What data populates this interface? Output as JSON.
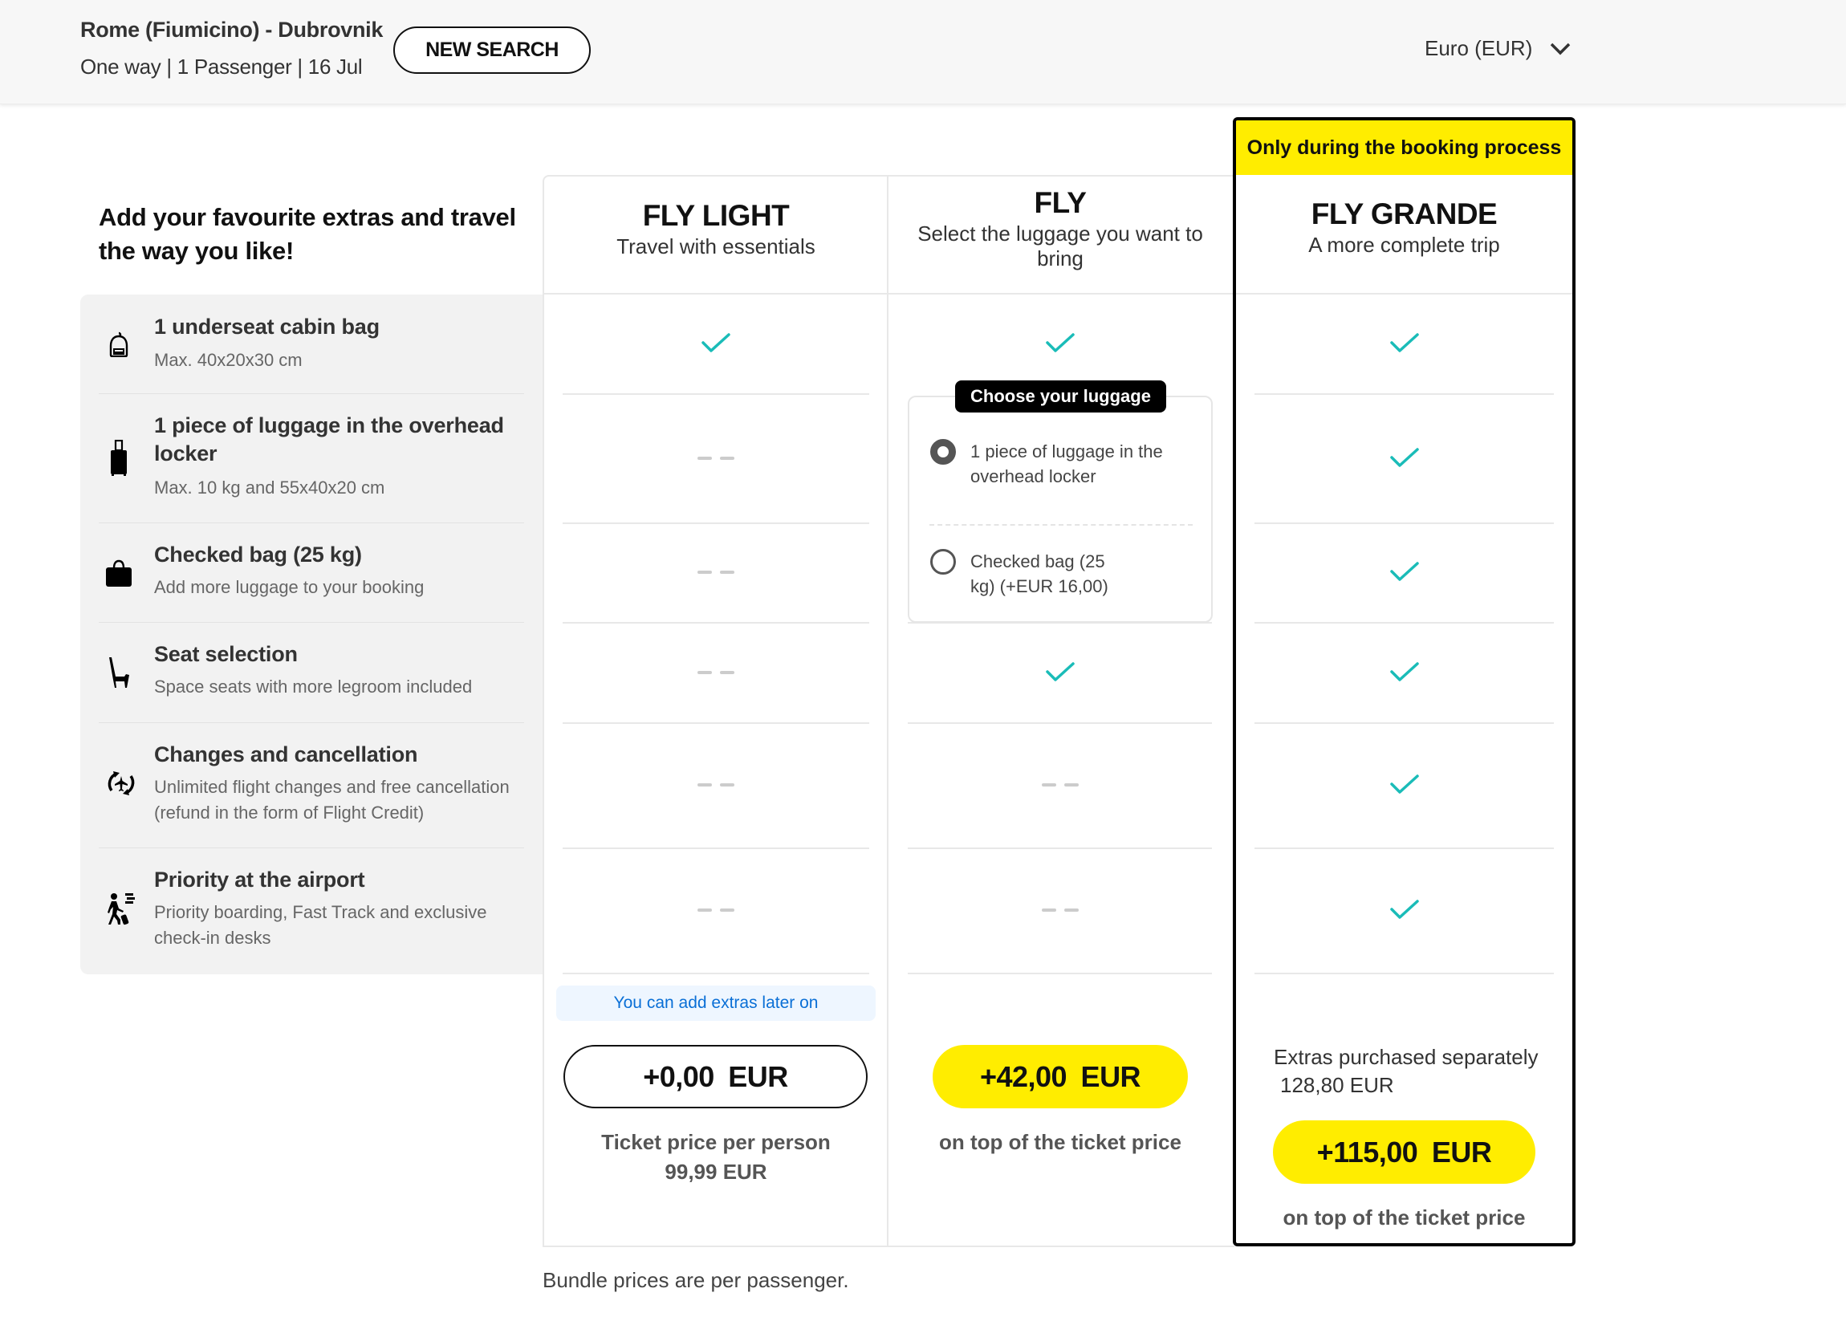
{
  "header": {
    "route": "Rome (Fiumicino) - Dubrovnik",
    "trip_info": "One way | 1 Passenger | 16 Jul",
    "new_search_label": "NEW SEARCH",
    "currency": "Euro (EUR)",
    "currency_icon": "chevron-down-icon"
  },
  "intro": "Add your favourite extras and travel the way you like!",
  "features": [
    {
      "title": "1 underseat cabin bag",
      "desc": "Max. 40x20x30 cm",
      "icon": "backpack-icon"
    },
    {
      "title": "1 piece of luggage in the overhead locker",
      "desc": "Max. 10 kg and 55x40x20 cm",
      "icon": "trolley-icon"
    },
    {
      "title": "Checked bag (25 kg)",
      "desc": "Add more luggage to your booking",
      "icon": "checked-bag-icon"
    },
    {
      "title": "Seat selection",
      "desc": "Space seats with more legroom included",
      "icon": "seat-icon"
    },
    {
      "title": "Changes and cancellation",
      "desc": "Unlimited flight changes and free cancellation (refund in the form of Flight Credit)",
      "icon": "flight-change-icon"
    },
    {
      "title": "Priority at the airport",
      "desc": "Priority boarding, Fast Track and exclusive check-in desks",
      "icon": "priority-passenger-icon"
    }
  ],
  "bundles": [
    {
      "name": "FLY LIGHT",
      "subtitle": "Travel with essentials",
      "features": [
        "included",
        "not-included",
        "not-included",
        "not-included",
        "not-included",
        "not-included"
      ],
      "note": "You can add extras later on",
      "price": "+0,00  EUR",
      "price_caption_line1": "Ticket price per person",
      "price_caption_line2": "99,99  EUR"
    },
    {
      "name": "FLY",
      "subtitle": "Select the luggage you want to bring",
      "features": [
        "included",
        "choice",
        "choice",
        "included",
        "not-included",
        "not-included"
      ],
      "luggage_choice": {
        "title": "Choose your luggage",
        "options": [
          {
            "label": "1 piece of luggage in the overhead locker",
            "selected": true
          },
          {
            "label": "Checked bag (25 kg) (+EUR 16,00)",
            "selected": false
          }
        ]
      },
      "price": "+42,00  EUR",
      "price_caption": "on top of the ticket price"
    },
    {
      "name": "FLY GRANDE",
      "subtitle": "A more complete trip",
      "banner": "Only during the booking process",
      "features": [
        "included",
        "included",
        "included",
        "included",
        "included",
        "included"
      ],
      "extras_label": "Extras purchased separately",
      "extras_value": "128,80 EUR",
      "price": "+115,00  EUR",
      "price_caption": "on top of the ticket price"
    }
  ],
  "footer_note": "Bundle prices are per passenger.",
  "colors": {
    "accent_yellow": "#ffed00",
    "check_teal": "#1abcb8",
    "dash_gray": "#cccccc",
    "info_blue": "#0a6fd6"
  }
}
